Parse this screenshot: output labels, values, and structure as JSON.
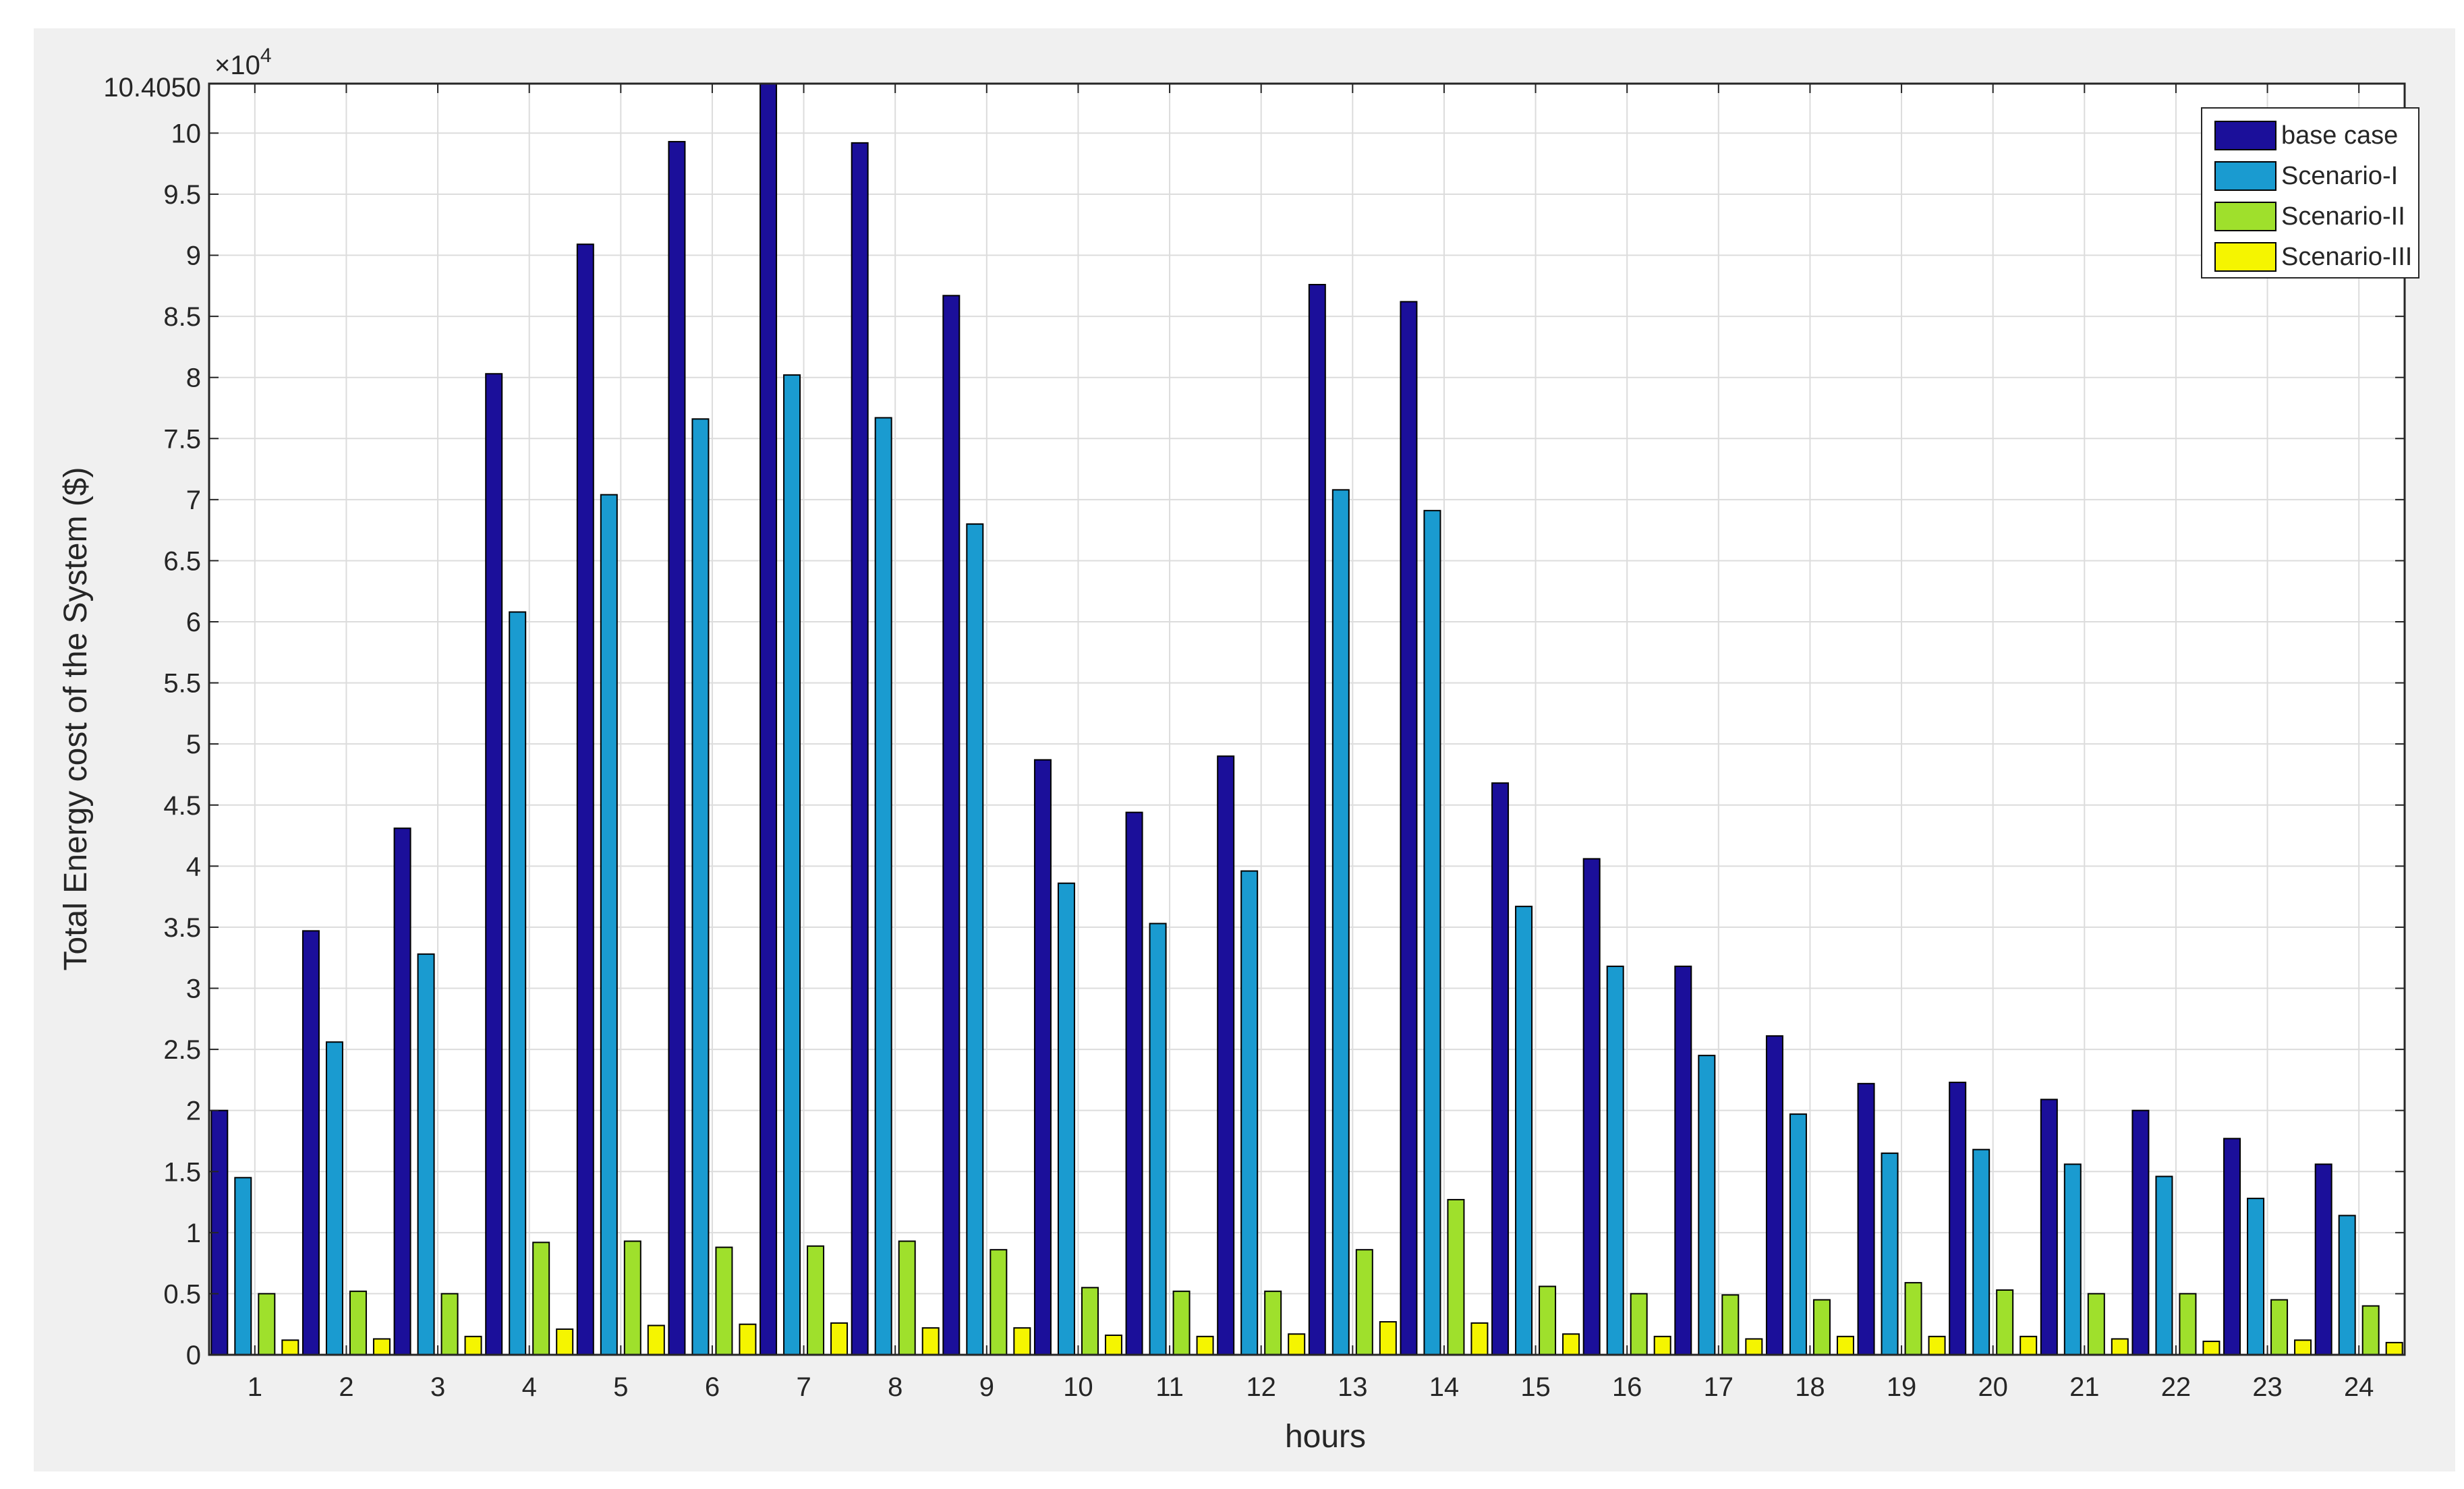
{
  "chart_data": {
    "type": "bar",
    "title": "",
    "xlabel": "hours",
    "ylabel": "Total Energy cost of the System ($)",
    "y_exponent_label": "×10",
    "y_exponent": "4",
    "ylim": [
      0,
      10.405
    ],
    "y_top_label": "10.4050",
    "y_ticks": [
      0,
      0.5,
      1,
      1.5,
      2,
      2.5,
      3,
      3.5,
      4,
      4.5,
      5,
      5.5,
      6,
      6.5,
      7,
      7.5,
      8,
      8.5,
      9,
      9.5,
      10
    ],
    "y_tick_labels": [
      "0",
      "0.5",
      "1",
      "1.5",
      "2",
      "2.5",
      "3",
      "3.5",
      "4",
      "4.5",
      "5",
      "5.5",
      "6",
      "6.5",
      "7",
      "7.5",
      "8",
      "8.5",
      "9",
      "9.5",
      "10"
    ],
    "categories": [
      "1",
      "2",
      "3",
      "4",
      "5",
      "6",
      "7",
      "8",
      "9",
      "10",
      "11",
      "12",
      "13",
      "14",
      "15",
      "16",
      "17",
      "18",
      "19",
      "20",
      "21",
      "22",
      "23",
      "24"
    ],
    "grid": true,
    "legend_position": "top-right",
    "series": [
      {
        "name": "base case",
        "color": "#1b0f9a",
        "values": [
          2.0,
          3.47,
          4.31,
          8.03,
          9.09,
          9.93,
          10.405,
          9.92,
          8.67,
          4.87,
          4.44,
          4.9,
          8.76,
          8.62,
          4.68,
          4.06,
          3.18,
          2.61,
          2.22,
          2.23,
          2.09,
          2.0,
          1.77,
          1.56
        ]
      },
      {
        "name": "Scenario-I",
        "color": "#1a9bd0",
        "values": [
          1.45,
          2.56,
          3.28,
          6.08,
          7.04,
          7.66,
          8.02,
          7.67,
          6.8,
          3.86,
          3.53,
          3.96,
          7.08,
          6.91,
          3.67,
          3.18,
          2.45,
          1.97,
          1.65,
          1.68,
          1.56,
          1.46,
          1.28,
          1.14
        ]
      },
      {
        "name": "Scenario-II",
        "color": "#9fe02c",
        "values": [
          0.5,
          0.52,
          0.5,
          0.92,
          0.93,
          0.88,
          0.89,
          0.93,
          0.86,
          0.55,
          0.52,
          0.52,
          0.86,
          1.27,
          0.56,
          0.5,
          0.49,
          0.45,
          0.59,
          0.53,
          0.5,
          0.5,
          0.45,
          0.4
        ]
      },
      {
        "name": "Scenario-III",
        "color": "#f5f500",
        "values": [
          0.12,
          0.13,
          0.15,
          0.21,
          0.24,
          0.25,
          0.26,
          0.22,
          0.22,
          0.16,
          0.15,
          0.17,
          0.27,
          0.26,
          0.17,
          0.15,
          0.13,
          0.15,
          0.15,
          0.15,
          0.13,
          0.11,
          0.12,
          0.1
        ]
      }
    ]
  }
}
